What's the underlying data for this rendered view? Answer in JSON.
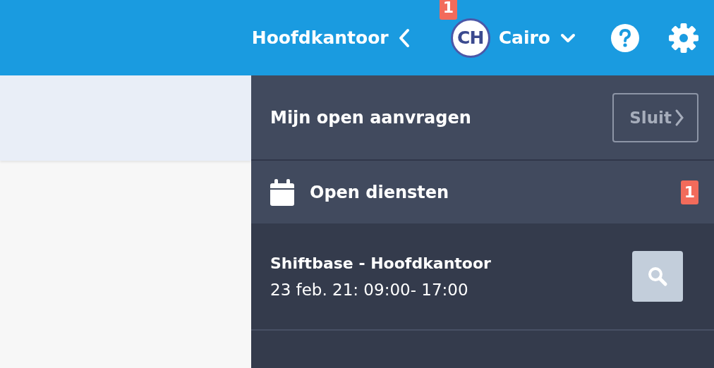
{
  "header": {
    "location": "Hoofdkantoor",
    "user": {
      "initials": "CH",
      "name": "Cairo",
      "badge": "1"
    }
  },
  "panel": {
    "title": "Mijn open aanvragen",
    "close_button": "Sluit",
    "section": {
      "title": "Open diensten",
      "count": "1"
    },
    "items": [
      {
        "title": "Shiftbase - Hoofdkantoor",
        "time": "23 feb. 21: 09:00- 17:00"
      }
    ]
  }
}
